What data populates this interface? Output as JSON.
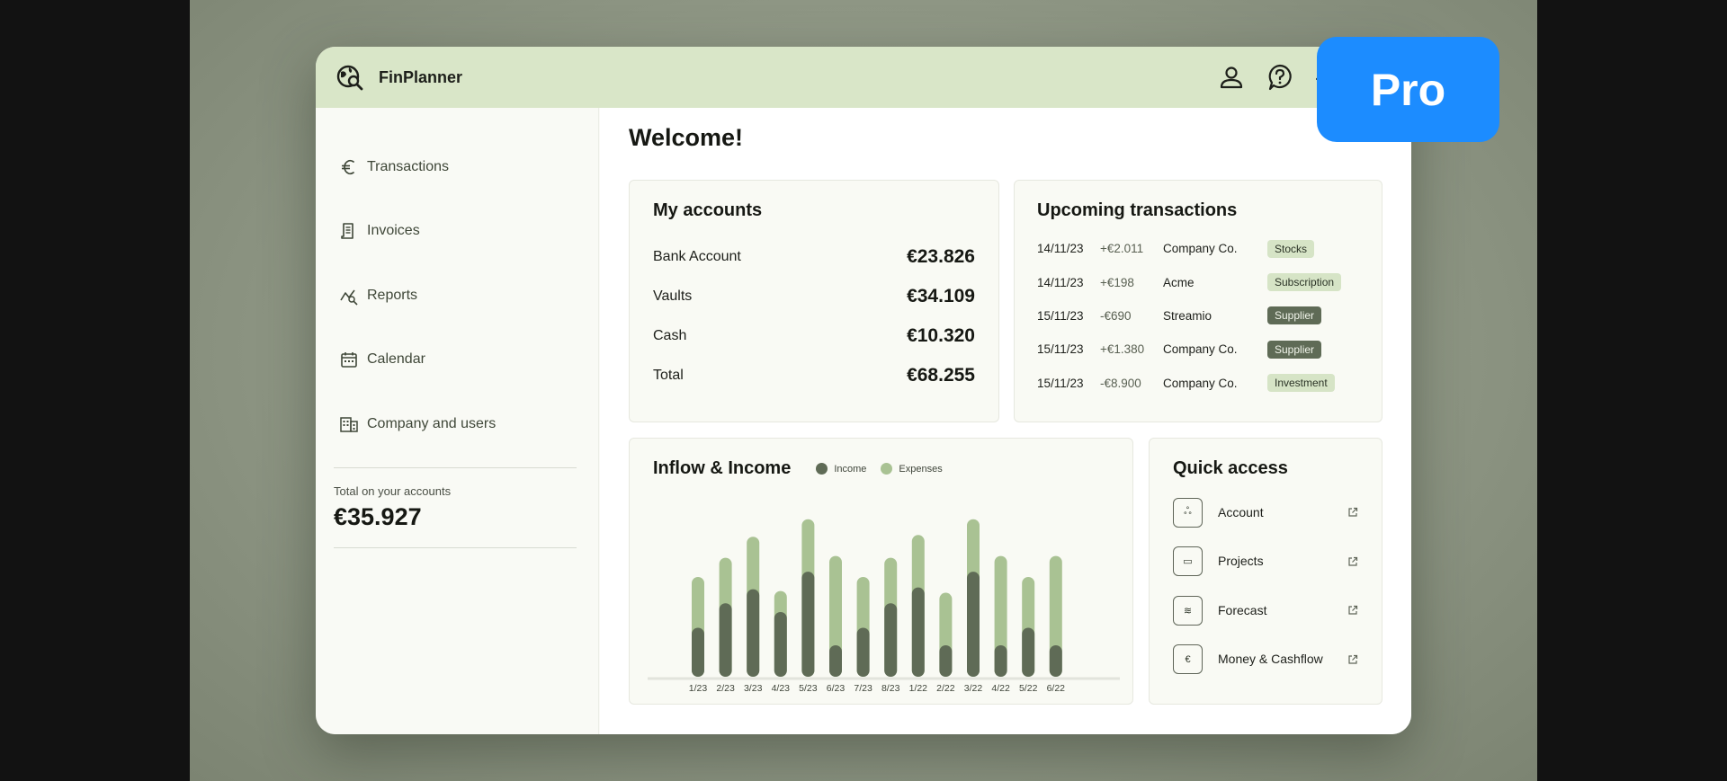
{
  "app": {
    "name": "FinPlanner"
  },
  "topbar": {
    "icons": [
      "user-icon",
      "help-icon",
      "settings-icon"
    ]
  },
  "sidebar": {
    "items": [
      {
        "label": "Transactions",
        "icon": "euro-icon"
      },
      {
        "label": "Invoices",
        "icon": "invoice-icon"
      },
      {
        "label": "Reports",
        "icon": "reports-icon"
      },
      {
        "label": "Calendar",
        "icon": "calendar-icon"
      },
      {
        "label": "Company and users",
        "icon": "building-icon"
      }
    ],
    "total_label": "Total on your accounts",
    "total_value": "€35.927"
  },
  "main": {
    "welcome": "Welcome!"
  },
  "accounts": {
    "title": "My accounts",
    "rows": [
      {
        "name": "Bank Account",
        "value": "€23.826"
      },
      {
        "name": "Vaults",
        "value": "€34.109"
      },
      {
        "name": "Cash",
        "value": "€10.320"
      },
      {
        "name": "Total",
        "value": "€68.255"
      }
    ]
  },
  "upcoming": {
    "title": "Upcoming transactions",
    "rows": [
      {
        "date": "14/11/23",
        "amount": "+€2.011",
        "party": "Company Co.",
        "tag": "Stocks",
        "tag_style": "light"
      },
      {
        "date": "14/11/23",
        "amount": "+€198",
        "party": "Acme",
        "tag": "Subscription",
        "tag_style": "light"
      },
      {
        "date": "15/11/23",
        "amount": "-€690",
        "party": "Streamio",
        "tag": "Supplier",
        "tag_style": "dark"
      },
      {
        "date": "15/11/23",
        "amount": "+€1.380",
        "party": "Company Co.",
        "tag": "Supplier",
        "tag_style": "dark"
      },
      {
        "date": "15/11/23",
        "amount": "-€8.900",
        "party": "Company Co.",
        "tag": "Investment",
        "tag_style": "light"
      }
    ]
  },
  "chart_card": {
    "title": "Inflow & Income"
  },
  "chart_data": {
    "type": "bar",
    "stacked": true,
    "title": "Inflow & Income",
    "legend_position": "top",
    "categories": [
      "1/23",
      "2/23",
      "3/23",
      "4/23",
      "5/23",
      "6/23",
      "7/23",
      "8/23",
      "1/22",
      "2/22",
      "3/22",
      "4/22",
      "5/22",
      "6/22"
    ],
    "series": [
      {
        "name": "Income",
        "color": "#5f6b56",
        "values": [
          28,
          42,
          50,
          37,
          60,
          18,
          28,
          42,
          51,
          18,
          60,
          18,
          28,
          18
        ]
      },
      {
        "name": "Expenses",
        "color": "#a9c293",
        "values": [
          29,
          26,
          30,
          12,
          30,
          51,
          29,
          26,
          30,
          30,
          30,
          51,
          29,
          51
        ]
      }
    ],
    "ylim": [
      0,
      95
    ],
    "grid": false
  },
  "quick_access": {
    "title": "Quick access",
    "items": [
      {
        "label": "Account",
        "glyph": "ஃ"
      },
      {
        "label": "Projects",
        "glyph": "▭"
      },
      {
        "label": "Forecast",
        "glyph": "≋"
      },
      {
        "label": "Money & Cashflow",
        "glyph": "€"
      }
    ]
  },
  "badge": {
    "label": "Pro",
    "color": "#1c8cff"
  }
}
